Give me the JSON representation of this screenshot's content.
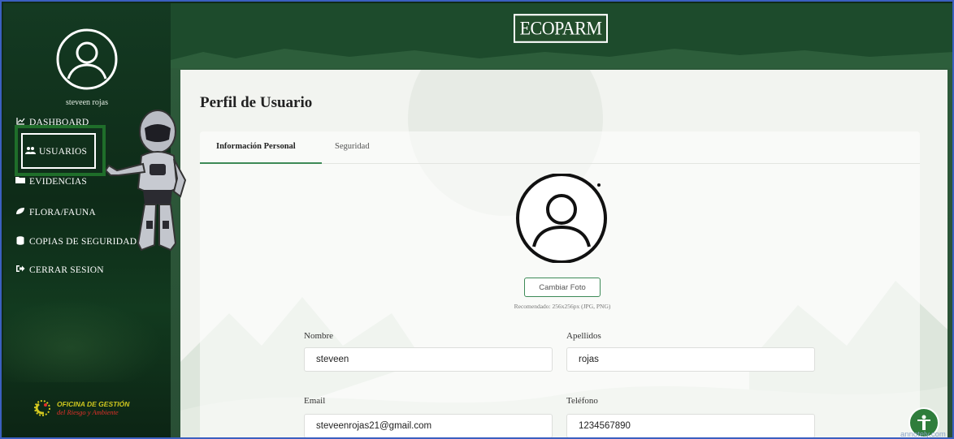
{
  "sidebar": {
    "username": "steveen rojas",
    "items": [
      {
        "label": "DASHBOARD",
        "icon": "chart-line-icon"
      },
      {
        "label": "USUARIOS",
        "icon": "users-icon"
      },
      {
        "label": "EVIDENCIAS",
        "icon": "folder-icon"
      },
      {
        "label": "FLORA/FAUNA",
        "icon": "leaf-icon"
      },
      {
        "label": "COPIAS DE SEGURIDAD",
        "icon": "database-icon"
      },
      {
        "label": "CERRAR SESION",
        "icon": "logout-icon"
      }
    ],
    "active_item": "USUARIOS",
    "footer_logo": {
      "line1": "OFICINA DE GESTIÓN",
      "line2": "del Riesgo y Ambiente"
    }
  },
  "header": {
    "brand": "ECOPARM"
  },
  "main": {
    "title": "Perfil de Usuario",
    "tabs": [
      {
        "label": "Información Personal",
        "active": true
      },
      {
        "label": "Seguridad",
        "active": false
      }
    ],
    "change_photo_label": "Cambiar Foto",
    "photo_hint": "Recomendado: 256x256px (JPG, PNG)",
    "fields": {
      "nombre": {
        "label": "Nombre",
        "value": "steveen"
      },
      "apellidos": {
        "label": "Apellidos",
        "value": "rojas"
      },
      "email": {
        "label": "Email",
        "value": "steveenrojas21@gmail.com"
      },
      "telefono": {
        "label": "Teléfono",
        "value": "1234567890"
      }
    }
  },
  "watermark": "annotely.com",
  "colors": {
    "accent": "#3d8a57",
    "sidebar": "#143a22",
    "highlight_box": "#1f6e2a"
  }
}
